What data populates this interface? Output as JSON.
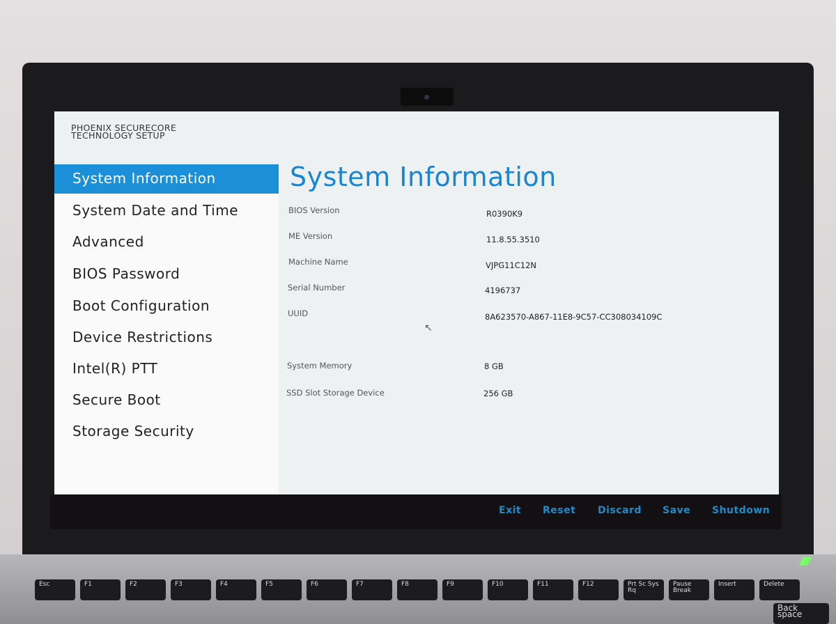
{
  "brand": {
    "line1": "PHOENIX SECURECORE",
    "line2": "TECHNOLOGY SETUP"
  },
  "sidebar": {
    "items": [
      {
        "label": "System Information",
        "active": true
      },
      {
        "label": "System Date and Time"
      },
      {
        "label": "Advanced"
      },
      {
        "label": "BIOS Password"
      },
      {
        "label": "Boot Configuration"
      },
      {
        "label": "Device Restrictions"
      },
      {
        "label": "Intel(R) PTT"
      },
      {
        "label": "Secure Boot"
      },
      {
        "label": "Storage Security"
      }
    ]
  },
  "main": {
    "title": "System Information",
    "fields": [
      {
        "label": "BIOS Version",
        "value": "R0390K9"
      },
      {
        "label": "ME Version",
        "value": "11.8.55.3510"
      },
      {
        "label": "Machine Name",
        "value": "VJPG11C12N"
      },
      {
        "label": "Serial Number",
        "value": "4196737"
      },
      {
        "label": "UUID",
        "value": "8A623570-A867-11E8-9C57-CC308034109C"
      },
      {
        "label": "System Memory",
        "value": "8 GB"
      },
      {
        "label": "SSD Slot Storage Device",
        "value": "256 GB"
      }
    ]
  },
  "actions": {
    "exit": "Exit",
    "reset": "Reset",
    "discard": "Discard",
    "save": "Save",
    "shutdown": "Shutdown"
  },
  "accent_color": "#1b8fd8",
  "keyboard": {
    "keys": [
      "Esc",
      "F1",
      "F2",
      "F3",
      "F4",
      "F5",
      "F6",
      "F7",
      "F8",
      "F9",
      "F10",
      "F11",
      "F12",
      "Prt Sc Sys Rq",
      "Pause Break",
      "Insert",
      "Delete"
    ],
    "backspace": "Back space"
  }
}
